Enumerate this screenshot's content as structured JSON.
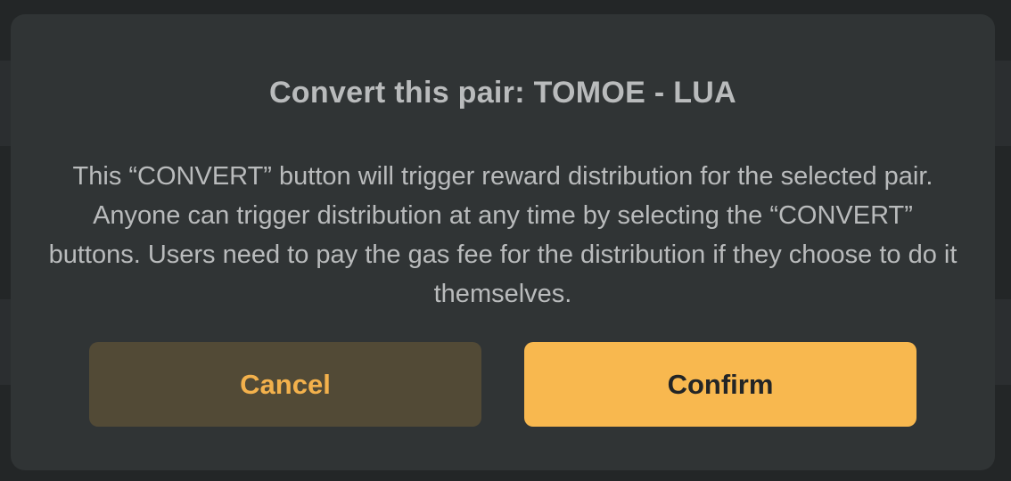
{
  "dialog": {
    "title": "Convert this pair: TOMOE - LUA",
    "message": "This “CONVERT” button will trigger reward distribution for the selected pair. Anyone can trigger distribution at any time by selecting the “CONVERT” buttons. Users need to pay the gas fee for the distribution if they choose to do it themselves.",
    "cancel_label": "Cancel",
    "confirm_label": "Confirm"
  },
  "colors": {
    "modal_background": "#303435",
    "text": "#b9bbbc",
    "accent": "#f8b84f",
    "cancel_background": "#524a36"
  }
}
